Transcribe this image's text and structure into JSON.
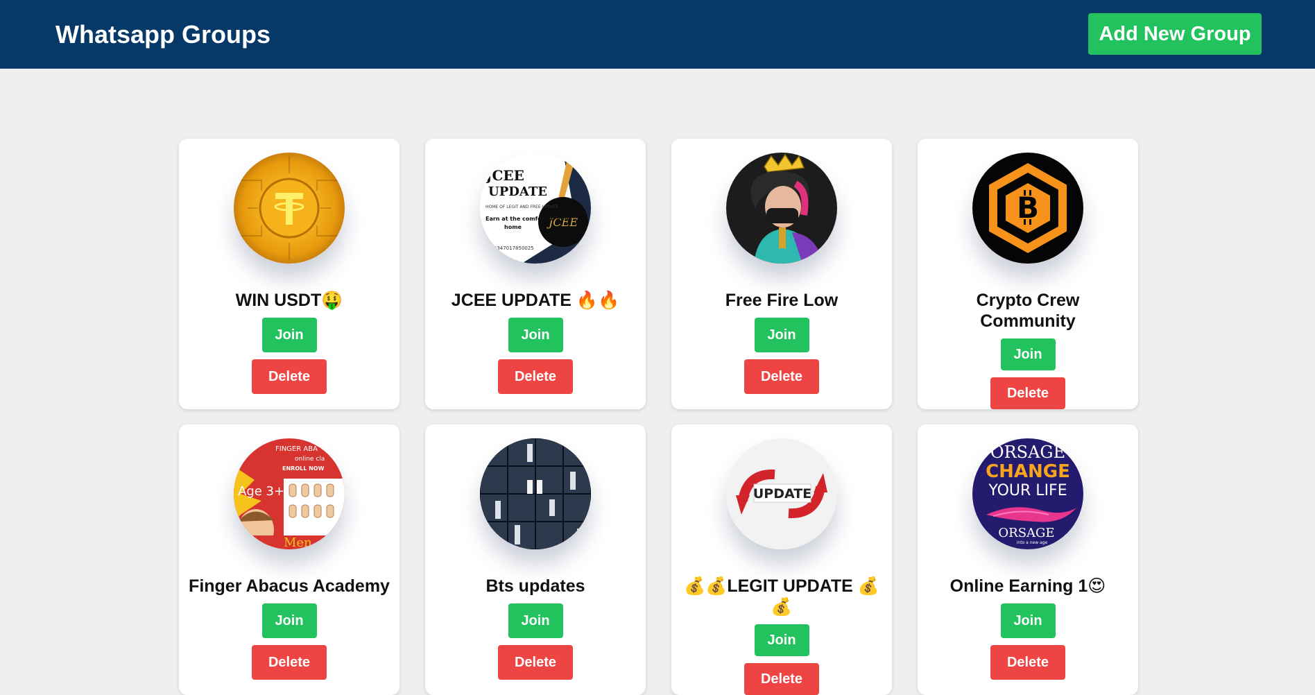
{
  "header": {
    "title": "Whatsapp Groups",
    "add_button_label": "Add New Group",
    "background": "#063868"
  },
  "colors": {
    "join": "#22c35e",
    "delete": "#ef4444",
    "page_background": "#efefef"
  },
  "groups": [
    {
      "name": "WIN USDT🤑",
      "join_label": "Join",
      "delete_label": "Delete",
      "avatar_text": "T"
    },
    {
      "name": "JCEE UPDATE 🔥🔥",
      "join_label": "Join",
      "delete_label": "Delete",
      "avatar_text": "JCEE UPDATE"
    },
    {
      "name": "Free Fire Low",
      "join_label": "Join",
      "delete_label": "Delete",
      "avatar_text": ""
    },
    {
      "name": "Crypto Crew Community",
      "join_label": "Join",
      "delete_label": "Delete",
      "avatar_text": "B"
    },
    {
      "name": "Finger Abacus Academy",
      "join_label": "Join",
      "delete_label": "Delete",
      "avatar_text": "Age 3+"
    },
    {
      "name": "Bts updates",
      "join_label": "Join",
      "delete_label": "Delete",
      "avatar_text": ""
    },
    {
      "name": "💰💰LEGIT UPDATE 💰💰",
      "join_label": "Join",
      "delete_label": "Delete",
      "avatar_text": "UPDATE"
    },
    {
      "name": "Online Earning 1😍",
      "join_label": "Join",
      "delete_label": "Delete",
      "avatar_text": "CHANGE YOUR LIFE"
    }
  ]
}
